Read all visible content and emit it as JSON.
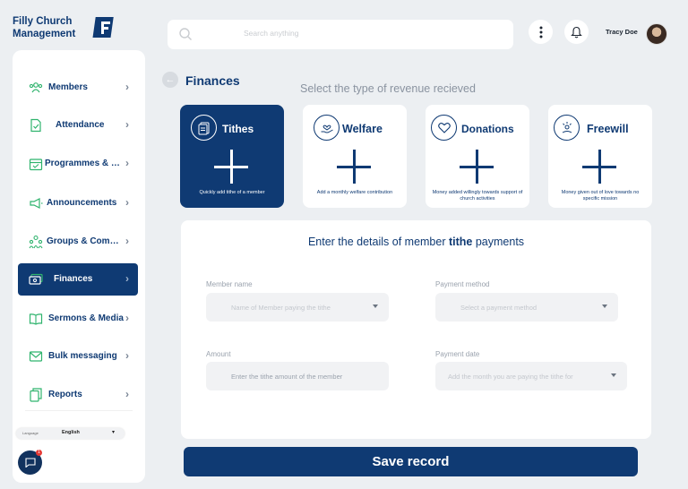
{
  "brand": {
    "line1": "Filly Church",
    "line2": "Management"
  },
  "search": {
    "placeholder": "Search anything"
  },
  "user": {
    "name": "Tracy Doe"
  },
  "sidebar": {
    "items": [
      {
        "label": "Members",
        "icon": "members-icon"
      },
      {
        "label": "Attendance",
        "icon": "attendance-icon"
      },
      {
        "label": "Programmes & Eve...",
        "icon": "calendar-icon"
      },
      {
        "label": "Announcements",
        "icon": "megaphone-icon"
      },
      {
        "label": "Groups & Committ...",
        "icon": "groups-icon"
      },
      {
        "label": "Finances",
        "icon": "money-icon",
        "active": true
      },
      {
        "label": "Sermons & Media",
        "icon": "book-icon"
      },
      {
        "label": "Bulk messaging",
        "icon": "mail-icon"
      },
      {
        "label": "Reports",
        "icon": "reports-icon"
      }
    ],
    "language": {
      "label": "Language",
      "value": "English"
    },
    "chat_badge": "1"
  },
  "page": {
    "title": "Finances",
    "subtitle": "Select the type of revenue recieved"
  },
  "cards": [
    {
      "title": "Tithes",
      "desc": "Quickly add tithe of a member",
      "active": true
    },
    {
      "title": "Welfare",
      "desc": "Add a monthly welfare contribution"
    },
    {
      "title": "Donations",
      "desc": "Money added willingly towards support of church activities"
    },
    {
      "title": "Freewill",
      "desc": "Money given out of love towards no specific mission"
    }
  ],
  "form": {
    "title_pre": "Enter the details of member ",
    "title_bold": "tithe",
    "title_post": " payments",
    "member_name": {
      "label": "Member name",
      "placeholder": "Name of Member paying the tithe"
    },
    "payment_method": {
      "label": "Payment method",
      "placeholder": "Select a payment method"
    },
    "amount": {
      "label": "Amount",
      "placeholder": "Enter the tithe amount of the member"
    },
    "payment_date": {
      "label": "Payment date",
      "placeholder": "Add the month you are paying the tithe for"
    }
  },
  "save_label": "Save record",
  "colors": {
    "primary": "#0f3a73",
    "accent": "#2fb36d",
    "background": "#eceff2"
  }
}
